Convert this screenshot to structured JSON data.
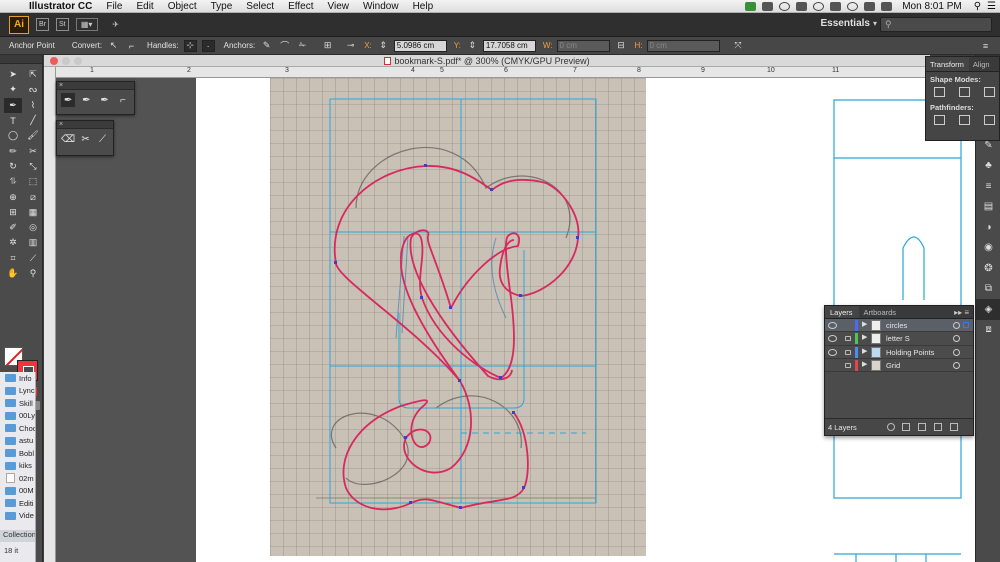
{
  "menubar": {
    "app_name": "Illustrator CC",
    "items": [
      "File",
      "Edit",
      "Object",
      "Type",
      "Select",
      "Effect",
      "View",
      "Window",
      "Help"
    ],
    "clock": "Mon 8:01 PM"
  },
  "appbar": {
    "logo": "Ai",
    "bridge": "Br",
    "stock": "St",
    "workspace": "Essentials",
    "search_placeholder": ""
  },
  "control_bar": {
    "tool_name": "Anchor Point",
    "convert_label": "Convert:",
    "handles_label": "Handles:",
    "anchors_label": "Anchors:",
    "x_label": "X:",
    "x_value": "5.0986 cm",
    "y_label": "Y:",
    "y_value": "17.7058 cm",
    "w_label": "W:",
    "w_value": "0 cm",
    "h_label": "H:",
    "h_value": "0 cm"
  },
  "document": {
    "title": "bookmark-S.pdf* @ 300% (CMYK/GPU Preview)",
    "ruler_labels": [
      "1",
      "2",
      "3",
      "4",
      "5",
      "6",
      "7",
      "8",
      "9",
      "10",
      "11"
    ]
  },
  "panels": {
    "transform_tabs": [
      "Transform",
      "Align"
    ],
    "shape_modes_label": "Shape Modes:",
    "pathfinders_label": "Pathfinders:",
    "layers_tabs": [
      "Layers",
      "Artboards"
    ],
    "layers": [
      {
        "name": "circles",
        "color": "#4a6cf2",
        "selected": true,
        "locked": false
      },
      {
        "name": "letter S",
        "color": "#4fc44f",
        "selected": false,
        "locked": true
      },
      {
        "name": "Holding Points",
        "color": "#4a8df2",
        "selected": false,
        "locked": true
      },
      {
        "name": "Grid",
        "color": "#e04848",
        "selected": false,
        "locked": true
      }
    ],
    "layers_count": "4 Layers"
  },
  "finder": {
    "items": [
      "Info",
      "Lync",
      "Skill",
      "00Ly",
      "Choc",
      "astu",
      "Bobl",
      "kiks",
      "02m",
      "00M",
      "Editi",
      "Vide"
    ],
    "collection_label": "Collection",
    "item_count": "18 it"
  },
  "colors": {
    "path_stroke": "#d8295e",
    "guide_color": "#2aa7d6",
    "anchor_color": "#3d3dd6",
    "fill_none_slash": "#e02020",
    "stroke_swatch": "#e8373f",
    "ai_logo": "#f5a623"
  }
}
